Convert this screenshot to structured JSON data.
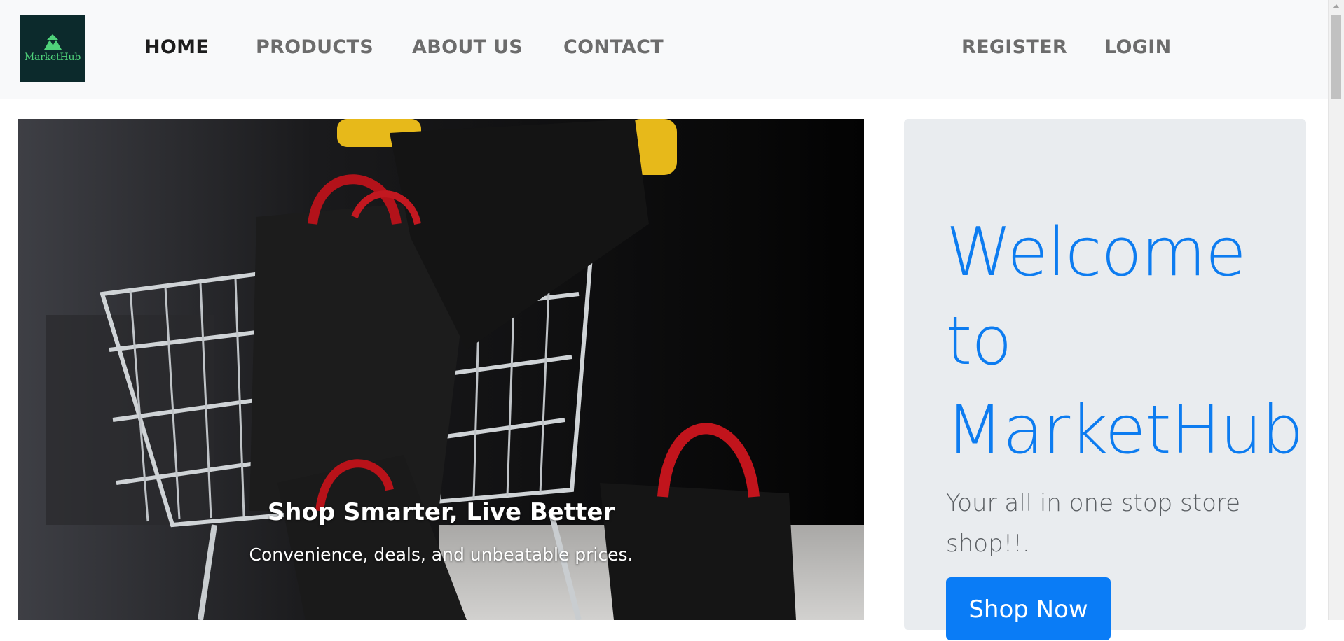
{
  "brand": {
    "logo_text": "MarketHub",
    "logo_icon": "mountain-triangle-icon",
    "accent": "#4fd27a",
    "bg": "#0c2a2c"
  },
  "nav": {
    "home": "HOME",
    "products": "PRODUCTS",
    "about": "ABOUT US",
    "contact": "CONTACT",
    "register": "REGISTER",
    "login": "LOGIN"
  },
  "hero": {
    "title": "Shop Smarter, Live Better",
    "subtitle": "Convenience, deals, and unbeatable prices."
  },
  "welcome": {
    "heading": "Welcome to MarketHub",
    "lead": "Your all in one stop store shop!!.",
    "button": "Shop Now",
    "heading_color": "#0d7cf0",
    "button_color": "#0a7cf6"
  }
}
